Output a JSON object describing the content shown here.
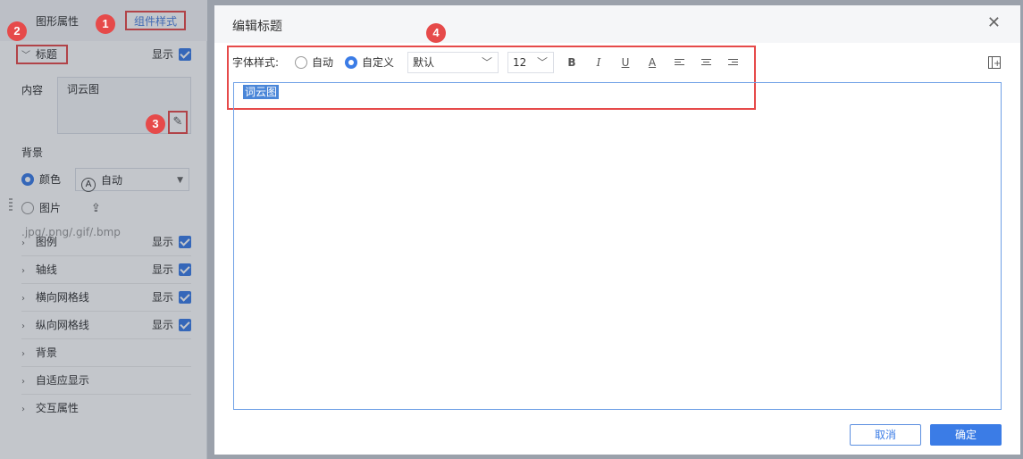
{
  "left_panel": {
    "tabs": [
      {
        "label": "图形属性"
      },
      {
        "label": "组件样式"
      }
    ],
    "title_section": {
      "label": "标题",
      "show_label": "显示",
      "checked": true
    },
    "content": {
      "label": "内容",
      "value": "词云图"
    },
    "background": {
      "label": "背景",
      "color_option": "颜色",
      "color_value": "自动",
      "image_option": "图片",
      "image_hint": ".jpg/.png/.gif/.bmp"
    },
    "sections": [
      {
        "label": "图例",
        "show_label": "显示",
        "checked": true
      },
      {
        "label": "轴线",
        "show_label": "显示",
        "checked": true
      },
      {
        "label": "横向网格线",
        "show_label": "显示",
        "checked": true
      },
      {
        "label": "纵向网格线",
        "show_label": "显示",
        "checked": true
      },
      {
        "label": "背景"
      },
      {
        "label": "自适应显示"
      },
      {
        "label": "交互属性"
      }
    ]
  },
  "markers": [
    "1",
    "2",
    "3",
    "4"
  ],
  "dialog": {
    "title": "编辑标题",
    "close_icon": "close-icon",
    "toolbar": {
      "font_style_label": "字体样式:",
      "auto_option": "自动",
      "custom_option": "自定义",
      "custom_selected": true,
      "font_family": "默认",
      "font_size": "12",
      "bold": "B",
      "italic": "I",
      "underline": "U",
      "font_color": "A"
    },
    "editor_text": "词云图",
    "buttons": {
      "cancel": "取消",
      "ok": "确定"
    }
  },
  "colors": {
    "accent": "#3b7ce6",
    "marker": "#e64a4a"
  }
}
